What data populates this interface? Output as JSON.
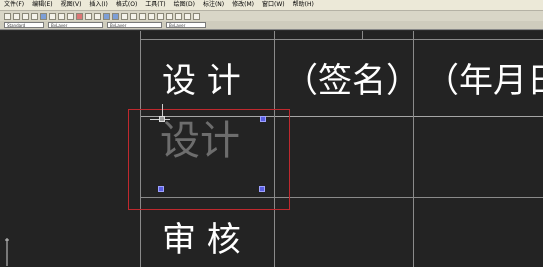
{
  "menubar": {
    "items": [
      "文件(F)",
      "编辑(E)",
      "视图(V)",
      "插入(I)",
      "格式(O)",
      "工具(T)",
      "绘图(D)",
      "标注(N)",
      "修改(M)",
      "窗口(W)",
      "帮助(H)"
    ]
  },
  "toolbar": {
    "combo1": "Standard",
    "combo2": "ByLayer",
    "combo3": "ByLayer",
    "combo4": "ByLayer"
  },
  "table": {
    "row1": {
      "label": "设 计",
      "signature": "（签名）",
      "date": "（年月日"
    },
    "row2": {
      "ghost_text": "设计"
    },
    "row3": {
      "label": "审 核"
    }
  },
  "colors": {
    "canvas": "#232323",
    "selection": "#c0292e",
    "grip": "#5a5ee0"
  }
}
